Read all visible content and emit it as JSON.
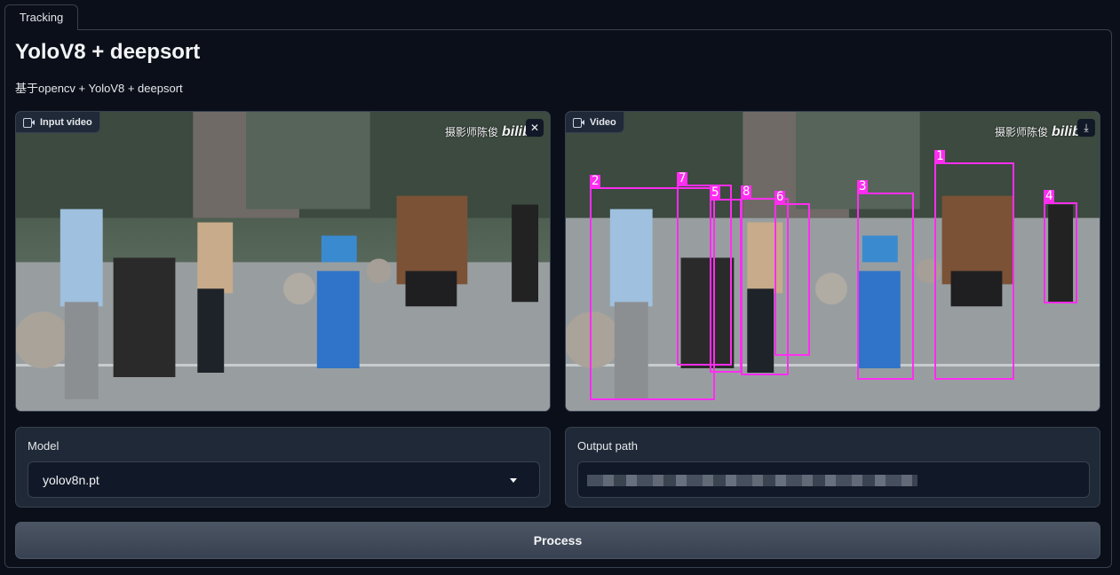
{
  "tabs": [
    {
      "label": "Tracking"
    }
  ],
  "header": {
    "title": "YoloV8 + deepsort",
    "description": "基于opencv + YoloV8 + deepsort"
  },
  "input_video": {
    "label": "Input video",
    "watermark_text": "摄影师陈俊",
    "watermark_logo": "bilibili"
  },
  "output_video": {
    "label": "Video",
    "watermark_text": "摄影师陈俊",
    "watermark_logo": "bilibili",
    "track_ids": [
      "2",
      "7",
      "5",
      "8",
      "6",
      "3",
      "1",
      "4"
    ]
  },
  "model": {
    "label": "Model",
    "selected": "yolov8n.pt"
  },
  "output_path": {
    "label": "Output path",
    "value_redacted": true
  },
  "actions": {
    "process_label": "Process"
  },
  "icons": {
    "video": "video-camera-icon",
    "clear": "close-icon",
    "download": "download-icon",
    "dropdown": "chevron-down-icon"
  },
  "colors": {
    "background": "#0b0f19",
    "panel": "#1f2937",
    "border": "#374151",
    "track_box": "#ff2df0",
    "button": "#4b5563"
  }
}
